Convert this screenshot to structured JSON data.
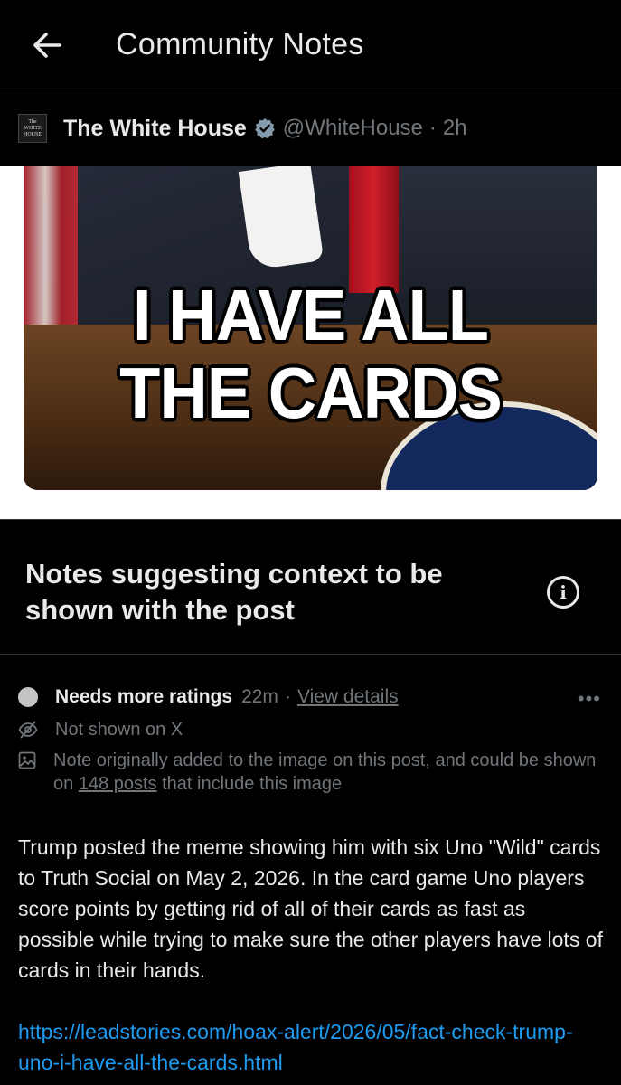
{
  "header": {
    "title": "Community Notes",
    "back_icon": "arrow-left-icon"
  },
  "post": {
    "author_name": "The White House",
    "author_handle": "@WhiteHouse",
    "time": "2h",
    "avatar_text_line1": "The",
    "avatar_text_line2": "WHITE",
    "avatar_text_line3": "HOUSE",
    "image_text_line1": "I HAVE ALL",
    "image_text_line2": "THE CARDS"
  },
  "notes_section": {
    "heading": "Notes suggesting context to be shown with the post"
  },
  "note": {
    "status": "Needs more ratings",
    "time": "22m",
    "view_details": "View details",
    "not_shown": "Not shown on X",
    "media_note_prefix": "Note originally added to the image on this post, and could be shown on ",
    "media_note_link": "148 posts",
    "media_note_suffix": " that include this image",
    "body": "Trump posted the meme showing him with six Uno \"Wild\" cards to Truth Social on May 2, 2026. In the card game Uno players score points by getting rid of all of their cards as fast as possible while trying to make sure the other players have lots of cards in their hands.",
    "link": "https://leadstories.com/hoax-alert/2026/05/fact-check-trump-uno-i-have-all-the-cards.html"
  },
  "colors": {
    "background": "#000000",
    "text": "#e7e9ea",
    "muted": "#71767b",
    "link": "#1d9bf0",
    "verified": "#829aab"
  }
}
